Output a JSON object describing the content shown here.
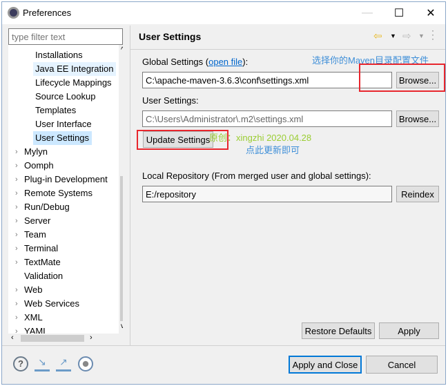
{
  "window": {
    "title": "Preferences",
    "icon": "eclipse-icon"
  },
  "filter": {
    "placeholder": "type filter text"
  },
  "tree": {
    "children": [
      {
        "label": "Installations"
      },
      {
        "label": "Java EE Integration",
        "state": "hover"
      },
      {
        "label": "Lifecycle Mappings"
      },
      {
        "label": "Source Lookup"
      },
      {
        "label": "Templates"
      },
      {
        "label": "User Interface"
      },
      {
        "label": "User Settings",
        "selected": true
      }
    ],
    "top": [
      {
        "label": "Mylyn",
        "chev": true
      },
      {
        "label": "Oomph",
        "chev": true
      },
      {
        "label": "Plug-in Development",
        "chev": true
      },
      {
        "label": "Remote Systems",
        "chev": true
      },
      {
        "label": "Run/Debug",
        "chev": true
      },
      {
        "label": "Server",
        "chev": true
      },
      {
        "label": "Team",
        "chev": true
      },
      {
        "label": "Terminal",
        "chev": true
      },
      {
        "label": "TextMate",
        "chev": true
      },
      {
        "label": "Validation",
        "chev": false
      },
      {
        "label": "Web",
        "chev": true
      },
      {
        "label": "Web Services",
        "chev": true
      },
      {
        "label": "XML",
        "chev": true
      },
      {
        "label": "YAML",
        "chev": true
      }
    ]
  },
  "page": {
    "title": "User Settings",
    "global_label": "Global Settings (",
    "open_file": "open file",
    "global_label_end": "):",
    "global_value": "C:\\apache-maven-3.6.3\\conf\\settings.xml",
    "browse": "Browse...",
    "user_label": "User Settings:",
    "user_value": "C:\\Users\\Administrator\\.m2\\settings.xml",
    "update": "Update Settings",
    "local_label": "Local Repository (From merged user and global settings):",
    "local_value": "E:/repository",
    "reindex": "Reindex",
    "restore": "Restore Defaults",
    "apply": "Apply"
  },
  "annotations": {
    "choose": "选择你的Maven目录配置文件",
    "author": "原创：xingzhi 2020.04.28",
    "update_hint": "点此更新即可"
  },
  "footer": {
    "apply_close": "Apply and Close",
    "cancel": "Cancel"
  },
  "colors": {
    "selection": "#cce8ff",
    "annotation_blue": "#3f8fd8",
    "annotation_green": "#9acd32",
    "highlight_red": "#e8262d"
  }
}
